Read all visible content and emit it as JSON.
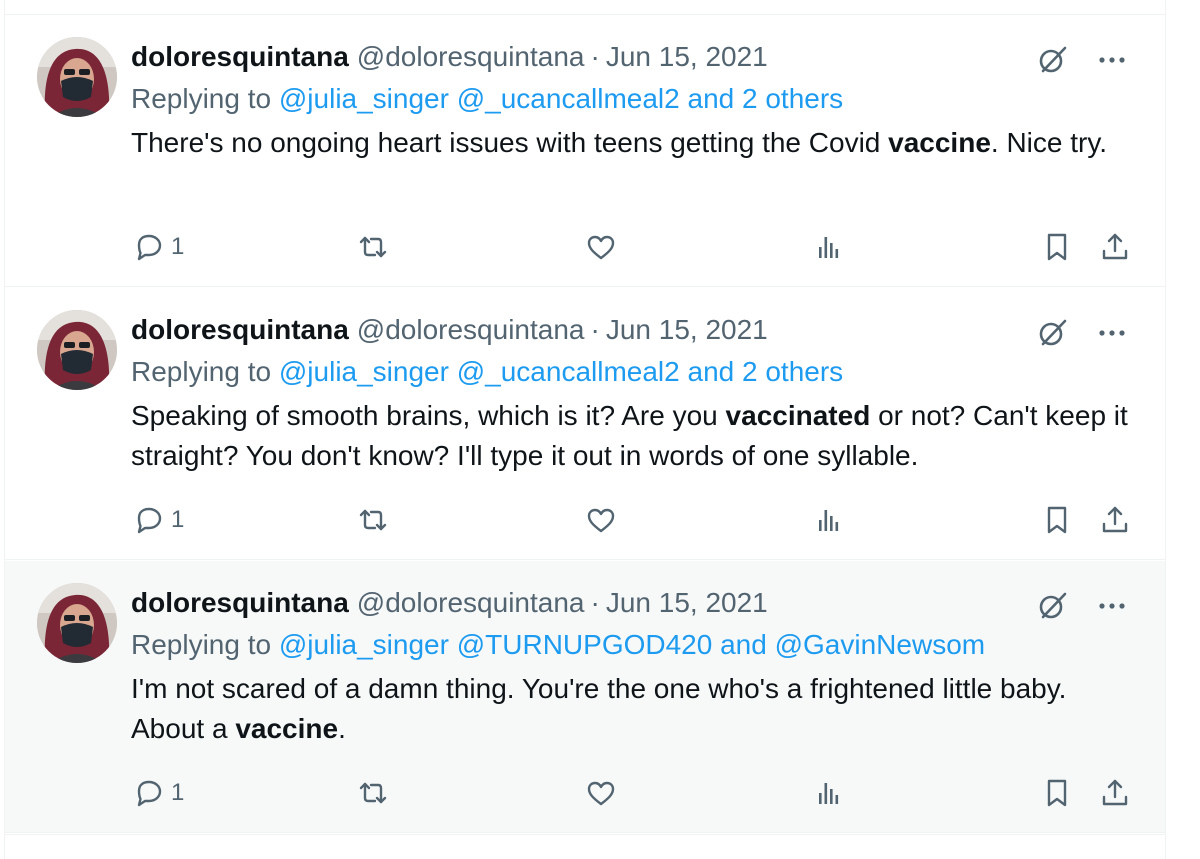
{
  "tweets": [
    {
      "name": "doloresquintana",
      "handle": "@doloresquintana",
      "separator": "·",
      "date": "Jun 15, 2021",
      "replying_prefix": "Replying to",
      "replying_mentions": [
        "@julia_singer",
        "@_ucancallmeal2"
      ],
      "replying_suffix": "and 2 others",
      "text_before": "There's no ongoing heart issues with teens getting the Covid ",
      "text_bold": "vaccine",
      "text_after": ". Nice try.",
      "reply_count": "1",
      "icons": [
        "grok-icon",
        "more-icon",
        "reply-icon",
        "retweet-icon",
        "like-icon",
        "views-icon",
        "bookmark-icon",
        "share-icon"
      ]
    },
    {
      "name": "doloresquintana",
      "handle": "@doloresquintana",
      "separator": "·",
      "date": "Jun 15, 2021",
      "replying_prefix": "Replying to",
      "replying_mentions": [
        "@julia_singer",
        "@_ucancallmeal2"
      ],
      "replying_suffix": "and 2 others",
      "text_before": "Speaking of smooth brains, which is it? Are you ",
      "text_bold": "vaccinated",
      "text_after": " or not? Can't keep it straight? You don't know? I'll type it out in words of one syllable.",
      "reply_count": "1",
      "icons": [
        "grok-icon",
        "more-icon",
        "reply-icon",
        "retweet-icon",
        "like-icon",
        "views-icon",
        "bookmark-icon",
        "share-icon"
      ]
    },
    {
      "name": "doloresquintana",
      "handle": "@doloresquintana",
      "separator": "·",
      "date": "Jun 15, 2021",
      "replying_prefix": "Replying to",
      "replying_mentions": [
        "@julia_singer",
        "@TURNUPGOD420"
      ],
      "replying_suffix": "and @GavinNewsom",
      "text_before": "I'm not scared of a damn thing. You're the one who's a frightened little baby. About a ",
      "text_bold": "vaccine",
      "text_after": ".",
      "reply_count": "1",
      "icons": [
        "grok-icon",
        "more-icon",
        "reply-icon",
        "retweet-icon",
        "like-icon",
        "views-icon",
        "bookmark-icon",
        "share-icon"
      ]
    }
  ],
  "colors": {
    "link": "#1d9bf0",
    "secondary_text": "#536471",
    "primary_text": "#0f1419",
    "highlight_bg": "#f7f9f9",
    "divider": "#eff3f4"
  }
}
